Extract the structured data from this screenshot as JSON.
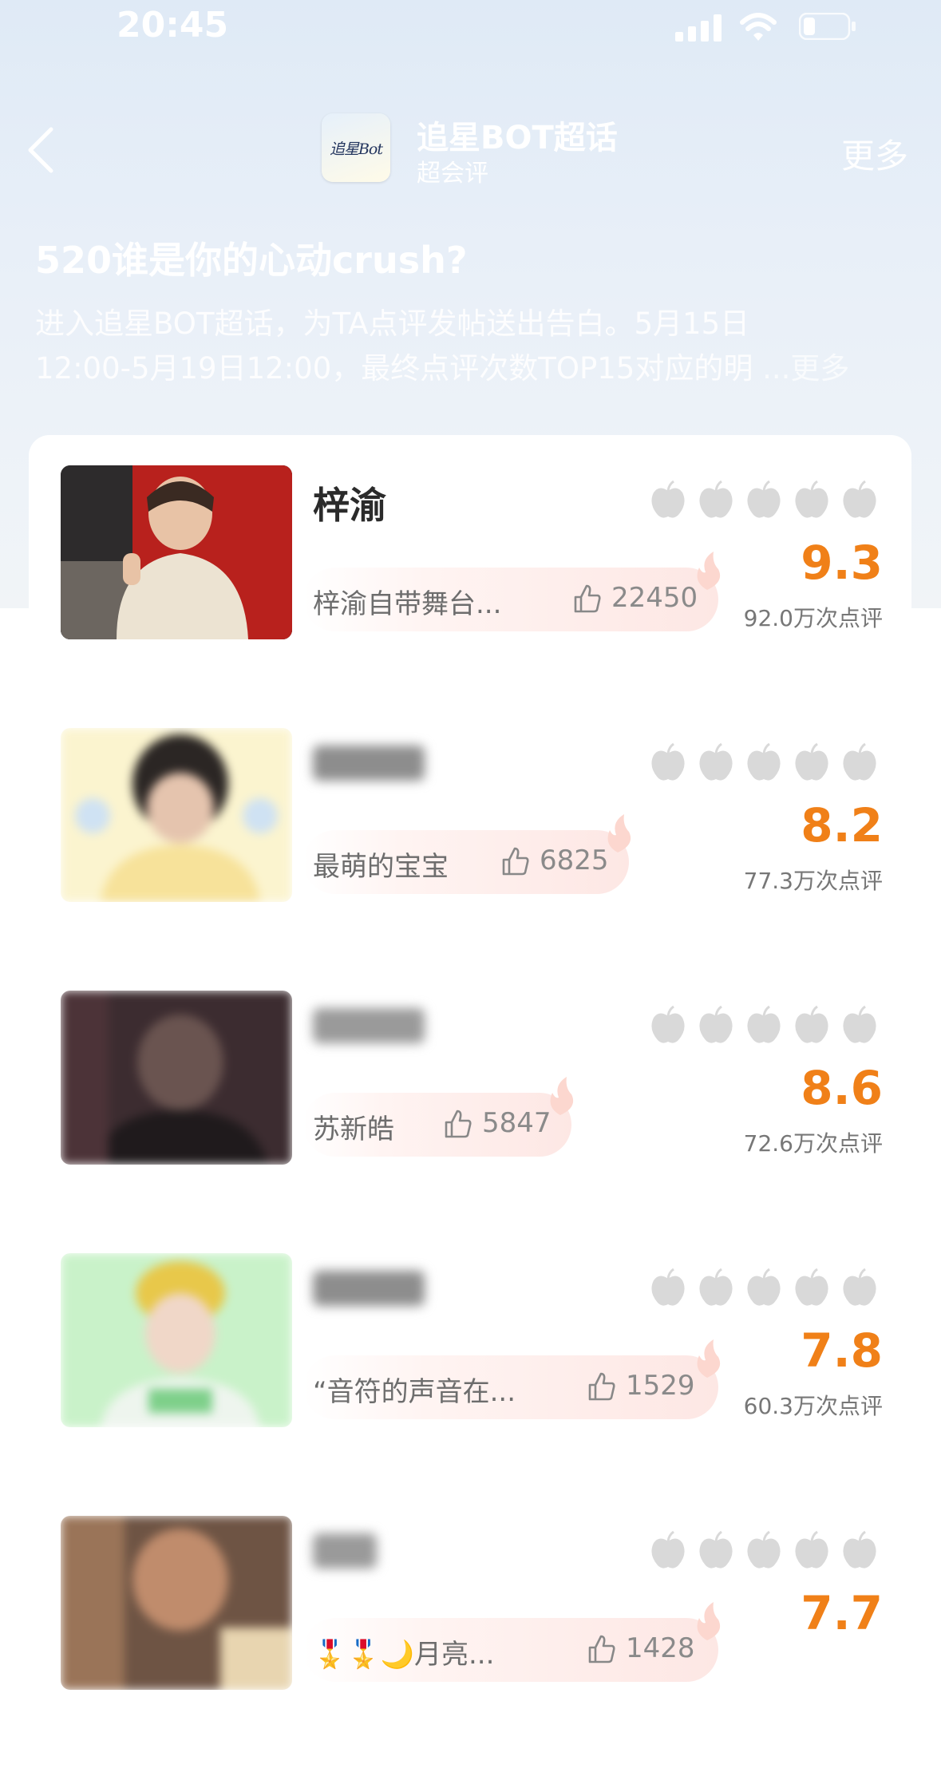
{
  "status_bar": {
    "time": "20:45"
  },
  "nav": {
    "logo_text": "追星Bot",
    "title": "追星BOT超话",
    "subtitle": "超会评",
    "more": "更多"
  },
  "headline": "520谁是你的心动crush?",
  "description": {
    "line1": "进入追星BOT超话，为TA点评发帖送出告白。5月15日",
    "line2": "12:00-5月19日12:00，最终点评次数TOP15对应的明",
    "more": "...更多"
  },
  "rows": [
    {
      "name": "梓渝",
      "comment": "梓渝自带舞台...",
      "likes": "22450",
      "score": "9.3",
      "reviews": "92.0万次点评"
    },
    {
      "name": "",
      "comment": "最萌的宝宝",
      "likes": "6825",
      "score": "8.2",
      "reviews": "77.3万次点评"
    },
    {
      "name": "",
      "comment": "苏新皓",
      "likes": "5847",
      "score": "8.6",
      "reviews": "72.6万次点评"
    },
    {
      "name": "",
      "comment": "“音符的声音在...",
      "likes": "1529",
      "score": "7.8",
      "reviews": "60.3万次点评"
    },
    {
      "name": "",
      "comment": "🎖️🎖️🌙月亮...",
      "likes": "1428",
      "score": "7.7",
      "reviews": ""
    }
  ],
  "icons": [
    "signal-icon",
    "wifi-icon",
    "battery-icon",
    "back-arrow-icon",
    "thumbs-up-icon",
    "apple-rating-icon",
    "flame-icon"
  ]
}
